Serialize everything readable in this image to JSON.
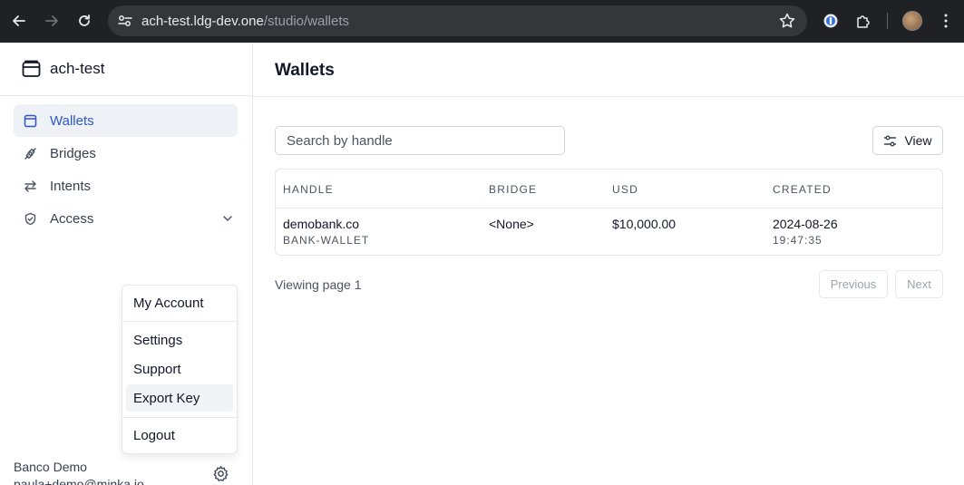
{
  "browser": {
    "url_host": "ach-test.ldg-dev.one",
    "url_path": "/studio/wallets"
  },
  "sidebar": {
    "brand": "ach-test",
    "nav": [
      {
        "label": "Wallets",
        "icon": "wallet-icon",
        "active": true
      },
      {
        "label": "Bridges",
        "icon": "plug-icon"
      },
      {
        "label": "Intents",
        "icon": "arrows-left-right-icon"
      },
      {
        "label": "Access",
        "icon": "shield-check-icon",
        "expandable": true
      }
    ],
    "user_menu": {
      "items": [
        "My Account",
        "Settings",
        "Support",
        "Export Key",
        "Logout"
      ],
      "hovered": "Export Key"
    },
    "user": {
      "name": "Banco Demo",
      "email": "paula+demo@minka.io"
    }
  },
  "main": {
    "title": "Wallets",
    "search_placeholder": "Search by handle",
    "view_label": "View",
    "table": {
      "columns": [
        "HANDLE",
        "BRIDGE",
        "USD",
        "CREATED"
      ],
      "rows": [
        {
          "handle": "demobank.co",
          "handle_sub": "BANK-WALLET",
          "bridge": "<None>",
          "usd": "$10,000.00",
          "created_date": "2024-08-26",
          "created_time": "19:47:35"
        }
      ]
    },
    "pagination": {
      "info": "Viewing page 1",
      "previous": "Previous",
      "next": "Next"
    }
  },
  "colors": {
    "accent": "#2f56c7",
    "active_bg": "#eef1f6",
    "chrome_bg": "#202124"
  }
}
